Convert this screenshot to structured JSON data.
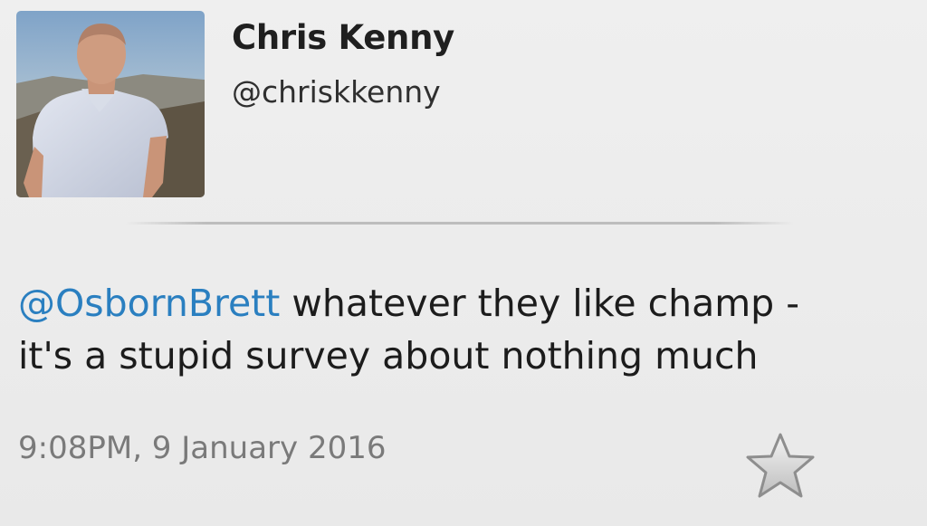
{
  "user": {
    "display_name": "Chris Kenny",
    "handle": "@chriskkenny",
    "avatar": "profile-photo"
  },
  "tweet": {
    "mention": "@OsbornBrett",
    "text_line1": " whatever they like champ -",
    "text_line2": "it's a stupid survey about nothing much",
    "timestamp": "9:08PM, 9 January 2016"
  },
  "icons": {
    "favorite": "star-icon"
  },
  "colors": {
    "mention": "#2a7fc0",
    "background": "#ececec",
    "timestamp": "#7a7a7a"
  }
}
